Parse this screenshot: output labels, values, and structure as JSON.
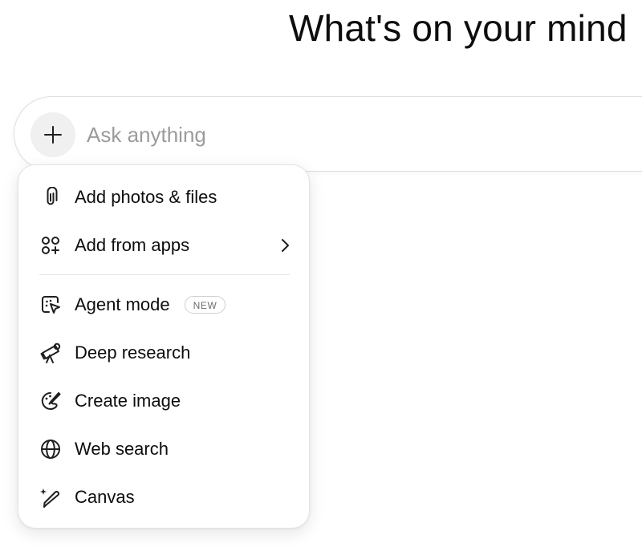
{
  "headline": "What's on your mind",
  "composer": {
    "placeholder": "Ask anything",
    "value": ""
  },
  "menu": {
    "items": [
      {
        "label": "Add photos & files",
        "icon": "paperclip-icon"
      },
      {
        "label": "Add from apps",
        "icon": "apps-icon",
        "has_submenu": true
      },
      {
        "label": "Agent mode",
        "icon": "agent-icon",
        "badge": "NEW"
      },
      {
        "label": "Deep research",
        "icon": "telescope-icon"
      },
      {
        "label": "Create image",
        "icon": "palette-icon"
      },
      {
        "label": "Web search",
        "icon": "globe-icon"
      },
      {
        "label": "Canvas",
        "icon": "canvas-pen-icon"
      }
    ]
  }
}
